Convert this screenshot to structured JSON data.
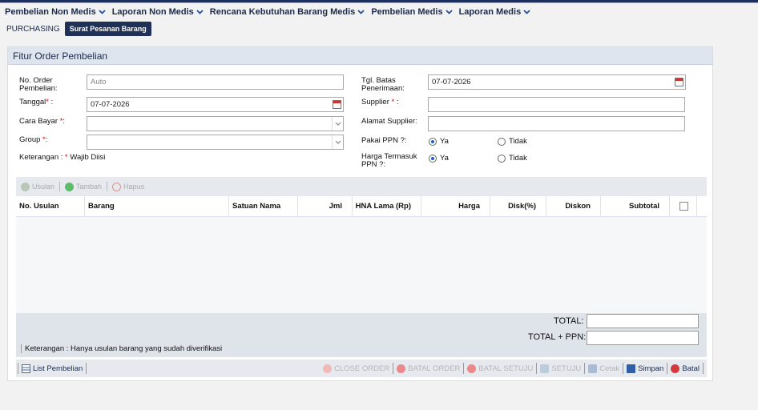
{
  "menu": [
    {
      "label": "Pembelian Non Medis"
    },
    {
      "label": "Laporan Non Medis"
    },
    {
      "label": "Rencana Kebutuhan Barang Medis"
    },
    {
      "label": "Pembelian Medis"
    },
    {
      "label": "Laporan Medis"
    }
  ],
  "breadcrumb": {
    "root": "PURCHASING",
    "active": "Surat Pesanan Barang"
  },
  "panel": {
    "title": "Fitur Order Pembelian"
  },
  "form": {
    "no_order_label_1": "No. Order",
    "no_order_label_2": "Pembelian:",
    "no_order_placeholder": "Auto",
    "tanggal_label": "Tanggal",
    "tanggal_value": "07-07-2026",
    "cara_bayar_label": "Cara Bayar",
    "group_label": "Group",
    "req_mark": "*",
    "colon": " :",
    "colon_tight": ":",
    "keterangan_prefix": "Keterangan :",
    "keterangan_suffix": "Wajib Diisi",
    "tgl_batas_label_1": "Tgl. Batas",
    "tgl_batas_label_2": "Penerimaan:",
    "tgl_batas_value": "07-07-2026",
    "supplier_label": "Supplier",
    "alamat_label": "Alamat Supplier:",
    "ppn_label": "Pakai PPN ?:",
    "harga_ppn_label_1": "Harga Termasuk",
    "harga_ppn_label_2": "PPN ?:",
    "ya": "Ya",
    "tidak": "Tidak"
  },
  "grid_toolbar": {
    "usulan": "Usulan",
    "tambah": "Tambah",
    "hapus": "Hapus"
  },
  "columns": [
    "No. Usulan",
    "Barang",
    "Satuan Nama",
    "Jml",
    "HNA Lama (Rp)",
    "Harga",
    "Disk(%)",
    "Diskon",
    "Subtotal"
  ],
  "totals": {
    "total_label": "TOTAL:",
    "total_ppn_label": "TOTAL + PPN:"
  },
  "note": "Keterangan : Hanya usulan barang yang sudah diverifikasi",
  "bottom": {
    "list": "List Pembelian",
    "close_order": "CLOSE ORDER",
    "batal_order": "BATAL ORDER",
    "batal_setuju": "BATAL SETUJU",
    "setuju": "SETUJU",
    "cetak": "Cetak",
    "simpan": "Simpan",
    "batal": "Batal"
  },
  "colors": {
    "accent": "#1f3157",
    "danger": "#d43a3a",
    "success": "#3aa84a"
  }
}
